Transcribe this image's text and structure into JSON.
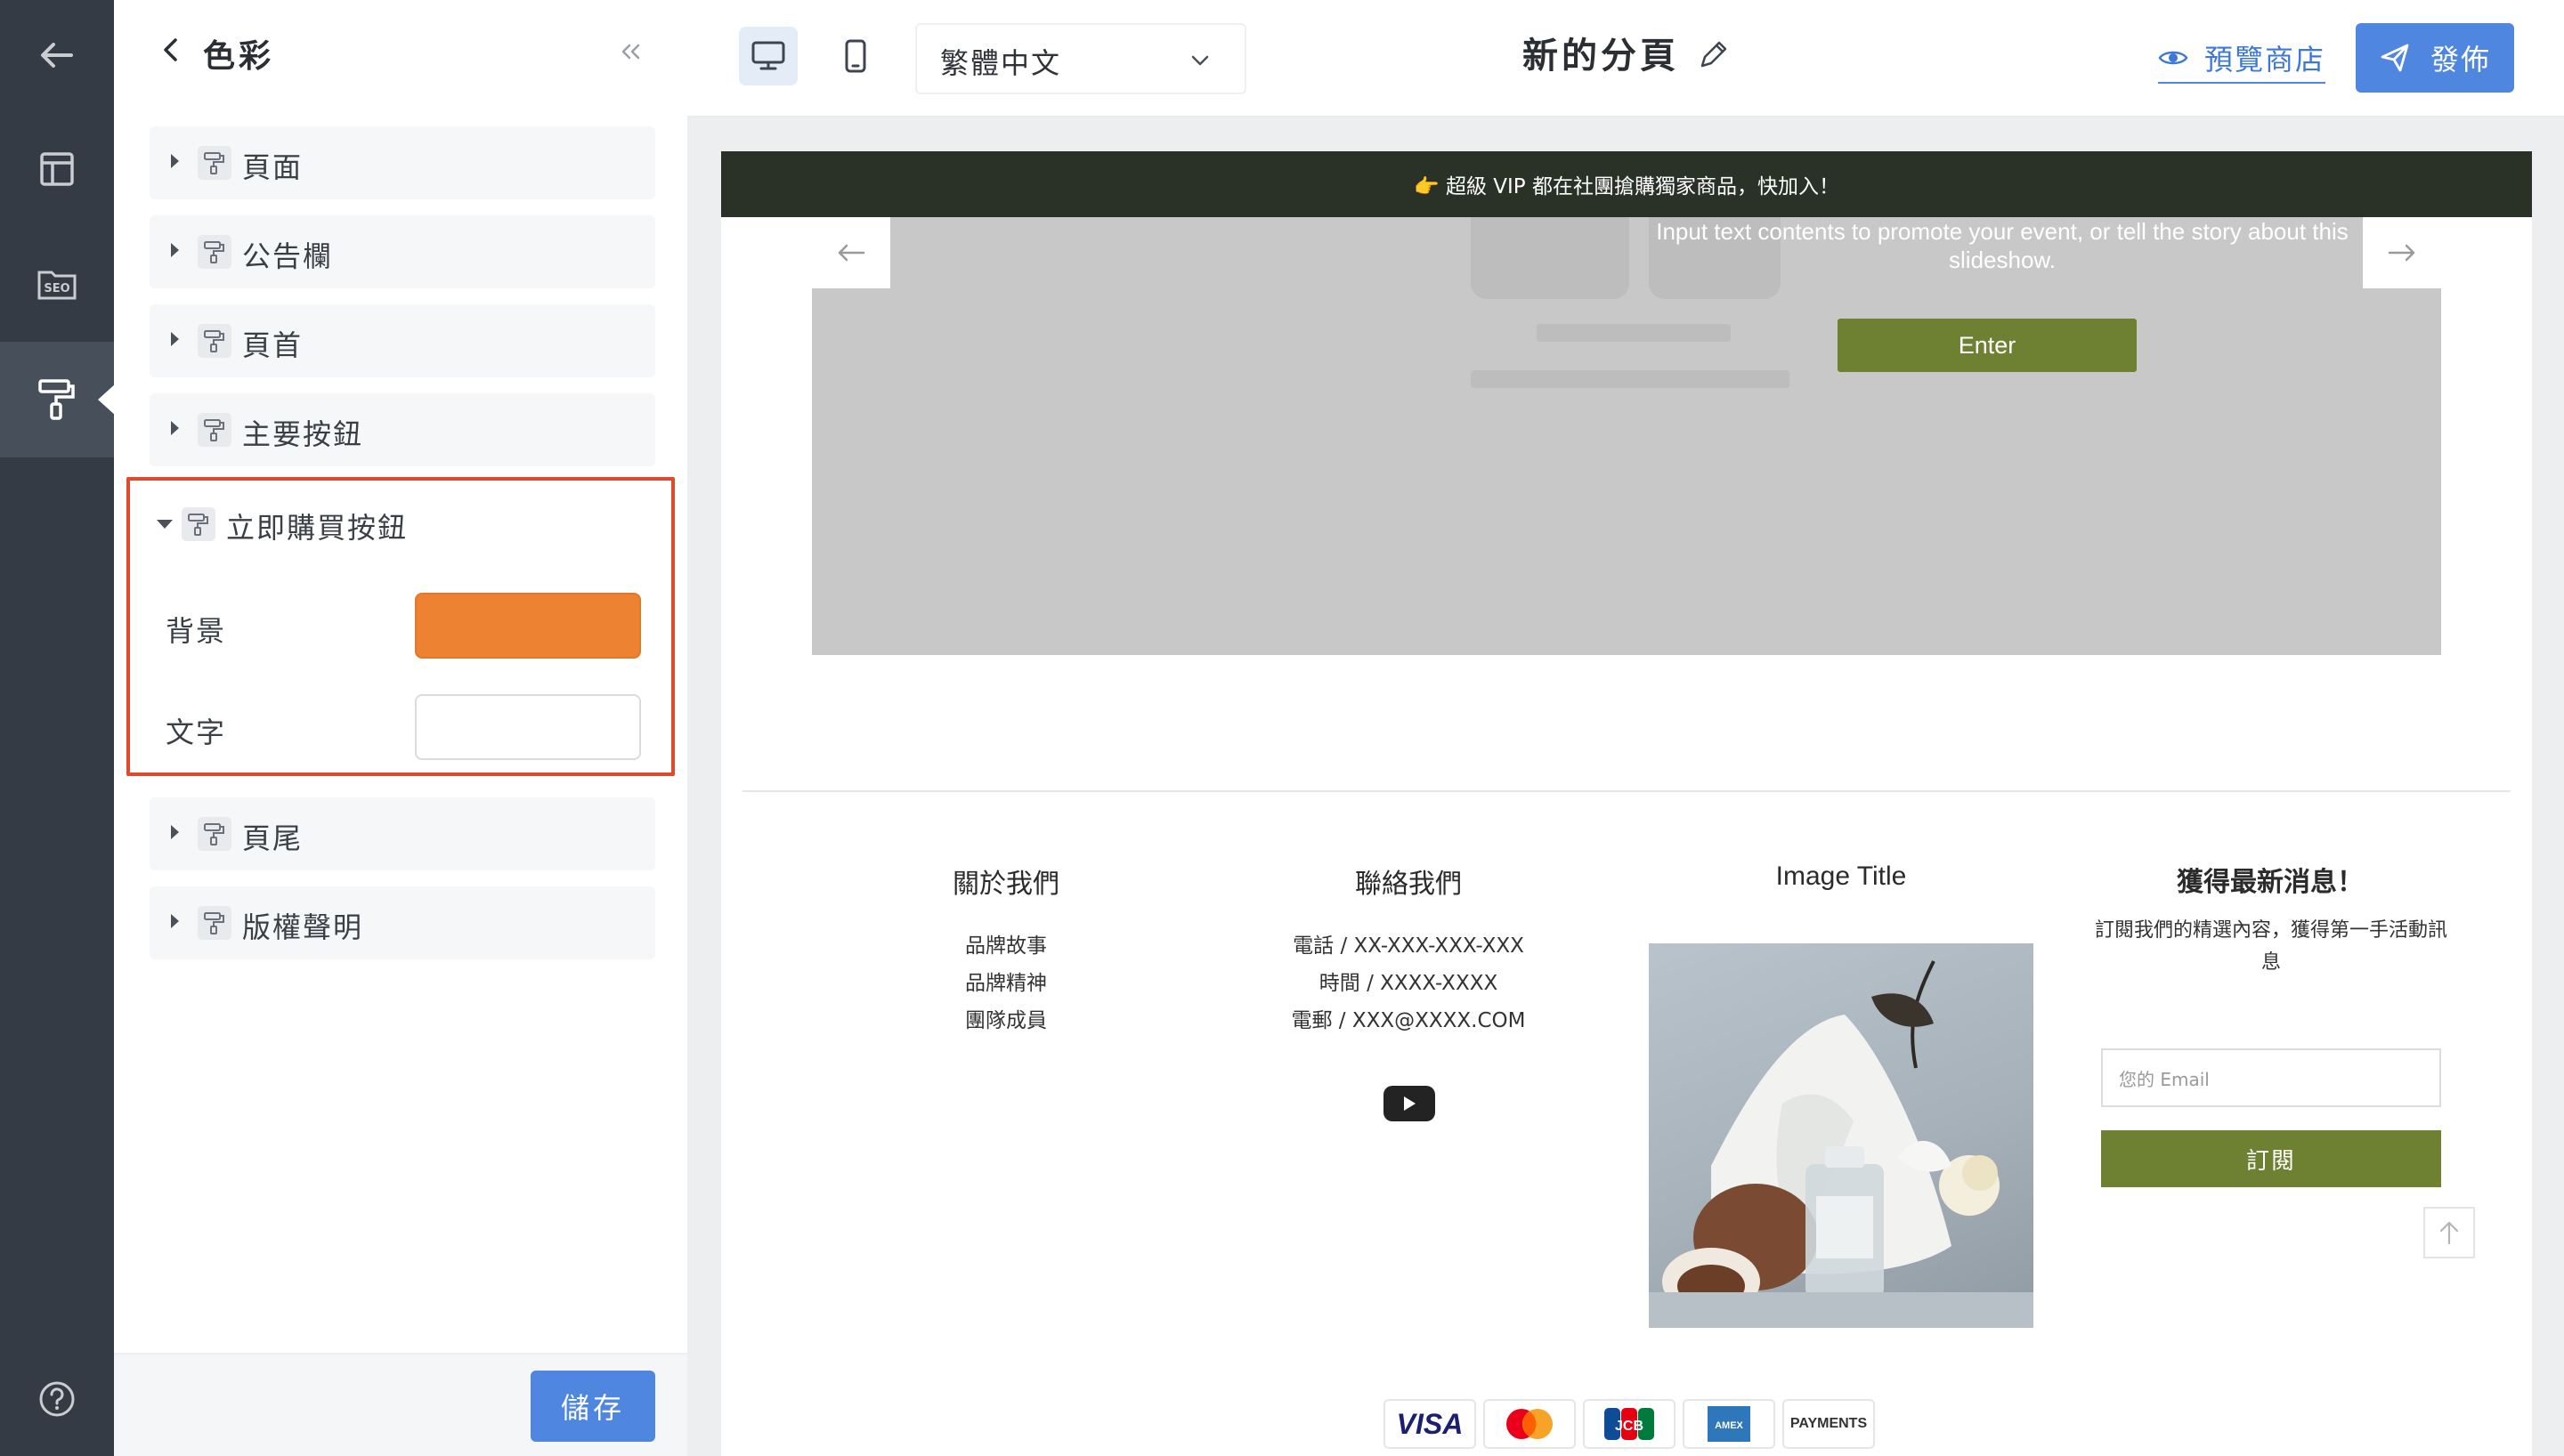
{
  "rail": {
    "items": [
      {
        "name": "back-arrow-icon"
      },
      {
        "name": "layout-icon"
      },
      {
        "name": "seo-icon",
        "label": "SEO"
      },
      {
        "name": "paint-roller-icon",
        "active": true
      },
      {
        "name": "help-icon"
      }
    ]
  },
  "panel": {
    "title": "色彩",
    "sections": [
      {
        "label": "頁面"
      },
      {
        "label": "公告欄"
      },
      {
        "label": "頁首"
      },
      {
        "label": "主要按鈕"
      }
    ],
    "open_section": {
      "label": "立即購買按鈕",
      "fields": [
        {
          "label": "背景",
          "color": "#ed8233"
        },
        {
          "label": "文字",
          "color": "#ffffff"
        }
      ]
    },
    "sections_after": [
      {
        "label": "頁尾"
      },
      {
        "label": "版權聲明"
      }
    ],
    "save_label": "儲存"
  },
  "topbar": {
    "language": "繁體中文",
    "page_title": "新的分頁",
    "preview_label": "預覽商店",
    "publish_label": "發佈"
  },
  "preview": {
    "announcement": "👉 超級 VIP 都在社團搶購獨家商品，快加入！",
    "slide_text": "Input text contents to promote your event, or tell the story about this slideshow.",
    "slide_button": "Enter",
    "footer": {
      "about": {
        "title": "關於我們",
        "links": [
          "品牌故事",
          "品牌精神",
          "團隊成員"
        ]
      },
      "contact": {
        "title": "聯絡我們",
        "lines": [
          "電話 / XX-XXX-XXX-XXX",
          "時間 / XXXX-XXXX",
          "電郵 / XXX@XXXX.COM"
        ]
      },
      "image_title": "Image Title",
      "newsletter": {
        "title": "獲得最新消息！",
        "desc": "訂閱我們的精選內容，獲得第一手活動訊息",
        "email_placeholder": "您的 Email",
        "button": "訂閱"
      },
      "payments": [
        "VISA",
        "Mastercard",
        "JCB",
        "AMEX",
        "PAYMENTS"
      ]
    }
  },
  "colors": {
    "accent": "#4f86e0",
    "olive": "#6e8133",
    "announce_bg": "#2a3127",
    "highlight": "#e0492d"
  }
}
